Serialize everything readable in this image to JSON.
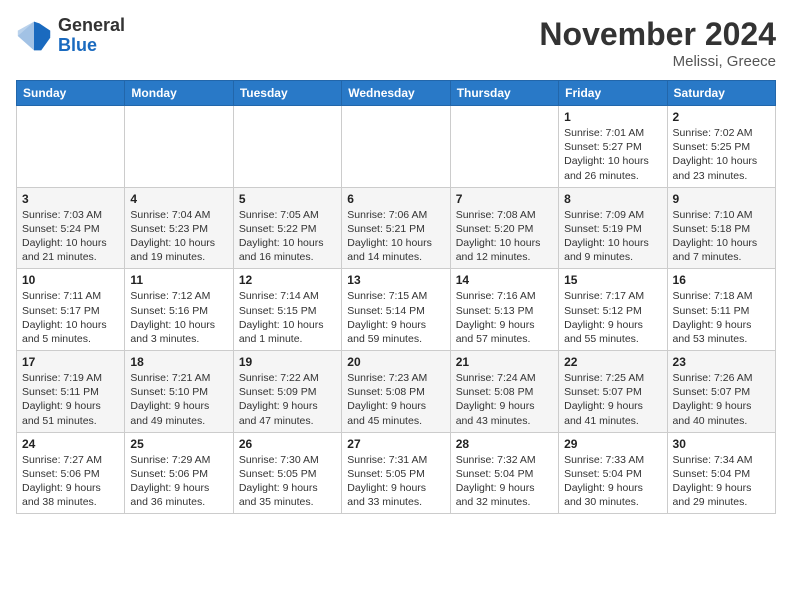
{
  "header": {
    "logo_general": "General",
    "logo_blue": "Blue",
    "month_title": "November 2024",
    "location": "Melissi, Greece"
  },
  "weekdays": [
    "Sunday",
    "Monday",
    "Tuesday",
    "Wednesday",
    "Thursday",
    "Friday",
    "Saturday"
  ],
  "weeks": [
    [
      {
        "day": "",
        "info": ""
      },
      {
        "day": "",
        "info": ""
      },
      {
        "day": "",
        "info": ""
      },
      {
        "day": "",
        "info": ""
      },
      {
        "day": "",
        "info": ""
      },
      {
        "day": "1",
        "info": "Sunrise: 7:01 AM\nSunset: 5:27 PM\nDaylight: 10 hours and 26 minutes."
      },
      {
        "day": "2",
        "info": "Sunrise: 7:02 AM\nSunset: 5:25 PM\nDaylight: 10 hours and 23 minutes."
      }
    ],
    [
      {
        "day": "3",
        "info": "Sunrise: 7:03 AM\nSunset: 5:24 PM\nDaylight: 10 hours and 21 minutes."
      },
      {
        "day": "4",
        "info": "Sunrise: 7:04 AM\nSunset: 5:23 PM\nDaylight: 10 hours and 19 minutes."
      },
      {
        "day": "5",
        "info": "Sunrise: 7:05 AM\nSunset: 5:22 PM\nDaylight: 10 hours and 16 minutes."
      },
      {
        "day": "6",
        "info": "Sunrise: 7:06 AM\nSunset: 5:21 PM\nDaylight: 10 hours and 14 minutes."
      },
      {
        "day": "7",
        "info": "Sunrise: 7:08 AM\nSunset: 5:20 PM\nDaylight: 10 hours and 12 minutes."
      },
      {
        "day": "8",
        "info": "Sunrise: 7:09 AM\nSunset: 5:19 PM\nDaylight: 10 hours and 9 minutes."
      },
      {
        "day": "9",
        "info": "Sunrise: 7:10 AM\nSunset: 5:18 PM\nDaylight: 10 hours and 7 minutes."
      }
    ],
    [
      {
        "day": "10",
        "info": "Sunrise: 7:11 AM\nSunset: 5:17 PM\nDaylight: 10 hours and 5 minutes."
      },
      {
        "day": "11",
        "info": "Sunrise: 7:12 AM\nSunset: 5:16 PM\nDaylight: 10 hours and 3 minutes."
      },
      {
        "day": "12",
        "info": "Sunrise: 7:14 AM\nSunset: 5:15 PM\nDaylight: 10 hours and 1 minute."
      },
      {
        "day": "13",
        "info": "Sunrise: 7:15 AM\nSunset: 5:14 PM\nDaylight: 9 hours and 59 minutes."
      },
      {
        "day": "14",
        "info": "Sunrise: 7:16 AM\nSunset: 5:13 PM\nDaylight: 9 hours and 57 minutes."
      },
      {
        "day": "15",
        "info": "Sunrise: 7:17 AM\nSunset: 5:12 PM\nDaylight: 9 hours and 55 minutes."
      },
      {
        "day": "16",
        "info": "Sunrise: 7:18 AM\nSunset: 5:11 PM\nDaylight: 9 hours and 53 minutes."
      }
    ],
    [
      {
        "day": "17",
        "info": "Sunrise: 7:19 AM\nSunset: 5:11 PM\nDaylight: 9 hours and 51 minutes."
      },
      {
        "day": "18",
        "info": "Sunrise: 7:21 AM\nSunset: 5:10 PM\nDaylight: 9 hours and 49 minutes."
      },
      {
        "day": "19",
        "info": "Sunrise: 7:22 AM\nSunset: 5:09 PM\nDaylight: 9 hours and 47 minutes."
      },
      {
        "day": "20",
        "info": "Sunrise: 7:23 AM\nSunset: 5:08 PM\nDaylight: 9 hours and 45 minutes."
      },
      {
        "day": "21",
        "info": "Sunrise: 7:24 AM\nSunset: 5:08 PM\nDaylight: 9 hours and 43 minutes."
      },
      {
        "day": "22",
        "info": "Sunrise: 7:25 AM\nSunset: 5:07 PM\nDaylight: 9 hours and 41 minutes."
      },
      {
        "day": "23",
        "info": "Sunrise: 7:26 AM\nSunset: 5:07 PM\nDaylight: 9 hours and 40 minutes."
      }
    ],
    [
      {
        "day": "24",
        "info": "Sunrise: 7:27 AM\nSunset: 5:06 PM\nDaylight: 9 hours and 38 minutes."
      },
      {
        "day": "25",
        "info": "Sunrise: 7:29 AM\nSunset: 5:06 PM\nDaylight: 9 hours and 36 minutes."
      },
      {
        "day": "26",
        "info": "Sunrise: 7:30 AM\nSunset: 5:05 PM\nDaylight: 9 hours and 35 minutes."
      },
      {
        "day": "27",
        "info": "Sunrise: 7:31 AM\nSunset: 5:05 PM\nDaylight: 9 hours and 33 minutes."
      },
      {
        "day": "28",
        "info": "Sunrise: 7:32 AM\nSunset: 5:04 PM\nDaylight: 9 hours and 32 minutes."
      },
      {
        "day": "29",
        "info": "Sunrise: 7:33 AM\nSunset: 5:04 PM\nDaylight: 9 hours and 30 minutes."
      },
      {
        "day": "30",
        "info": "Sunrise: 7:34 AM\nSunset: 5:04 PM\nDaylight: 9 hours and 29 minutes."
      }
    ]
  ]
}
